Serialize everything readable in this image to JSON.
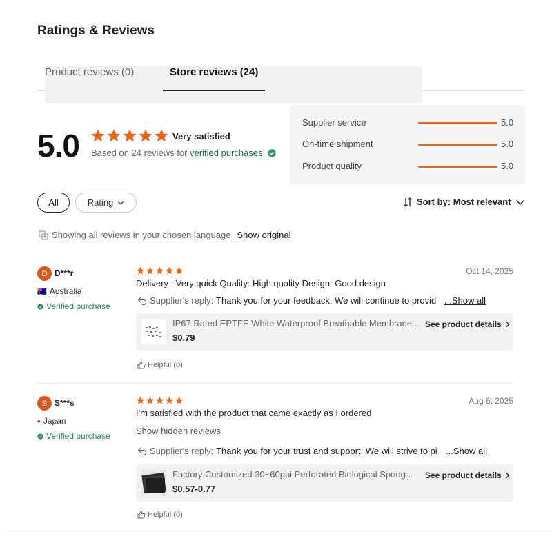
{
  "page": {
    "title": "Ratings & Reviews"
  },
  "tabs": [
    {
      "label": "Product reviews (0)"
    },
    {
      "label": "Store reviews (24)"
    }
  ],
  "summary": {
    "score": "5.0",
    "rating": 5,
    "rating_label": "Very satisfied",
    "based_on": "Based on 24 reviews for",
    "verified_link": "verified purchases"
  },
  "metrics": [
    {
      "label": "Supplier service",
      "value": "5.0",
      "fraction": 1.0
    },
    {
      "label": "On-time shipment",
      "value": "5.0",
      "fraction": 1.0
    },
    {
      "label": "Product quality",
      "value": "5.0",
      "fraction": 1.0
    }
  ],
  "filters": {
    "all_label": "All",
    "rating_label": "Rating"
  },
  "sort": {
    "prefix": "Sort by:",
    "value": "Most relevant"
  },
  "language_note": {
    "text": "Showing all reviews in your chosen language",
    "link": "Show original"
  },
  "reviews": [
    {
      "initial": "D",
      "name": "D***r",
      "flag": "🇦🇺",
      "country": "Australia",
      "verified": "Verified purchase",
      "rating": 5,
      "date": "Oct 14, 2025",
      "text": "Delivery : Very quick Quality: High quality Design: Good design",
      "hidden_link": "",
      "reply_label": "Supplier's reply:",
      "reply_text": "Thank you for your feedback. We will continue to provid",
      "show_all": "...Show all",
      "product_name": "IP67 Rated EPTFE White Waterproof Breathable Membrane...",
      "product_price": "$0.79",
      "product_details": "See product details",
      "helpful": "Helpful (0)"
    },
    {
      "initial": "S",
      "name": "S***s",
      "flag": "●",
      "country": "Japan",
      "verified": "Verified purchase",
      "rating": 5,
      "date": "Aug 6, 2025",
      "text": "I'm satisfied with the product that came exactly as I ordered",
      "hidden_link": "Show hidden reviews",
      "reply_label": "Supplier's reply:",
      "reply_text": "Thank you for your trust and support. We will strive to pi",
      "show_all": "...Show all",
      "product_name": "Factory Customized 30~60ppi Perforated Biological Spong...",
      "product_price": "$0.57-0.77",
      "product_details": "See product details",
      "helpful": "Helpful (0)"
    }
  ],
  "colors": {
    "accent": "#e06a1b",
    "star": "#e8651a",
    "verified": "#1a8a4a",
    "avatar": "#d65a1f"
  }
}
